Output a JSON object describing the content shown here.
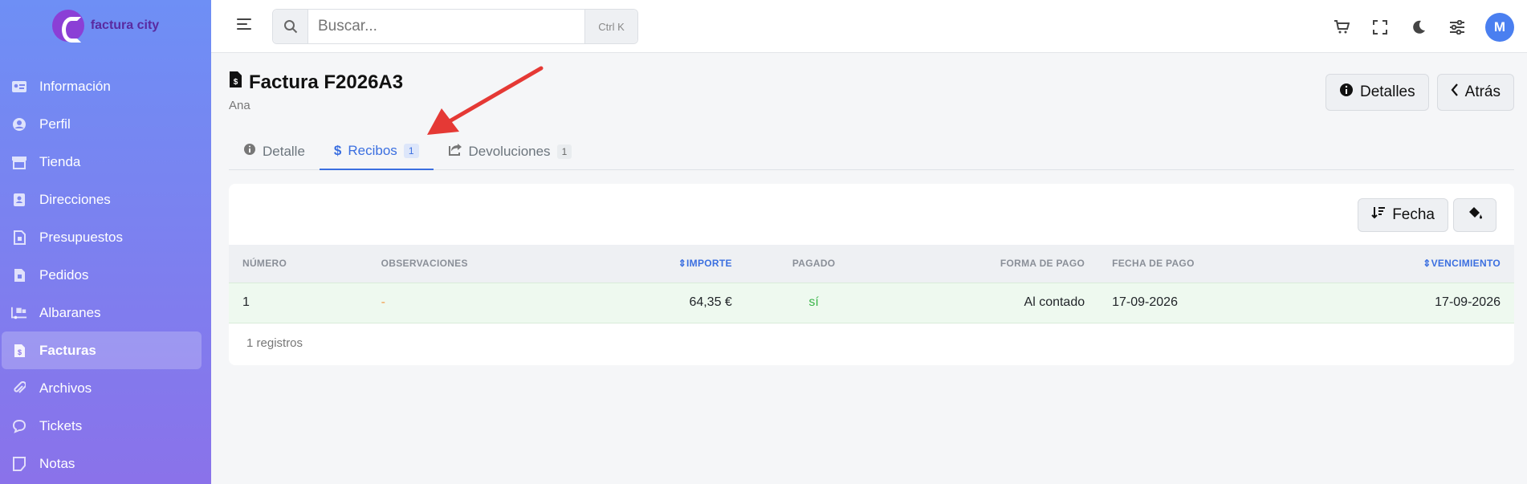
{
  "brand": {
    "name": "factura city"
  },
  "sidebar": {
    "items": [
      {
        "label": "Información",
        "icon": "id-card-icon"
      },
      {
        "label": "Perfil",
        "icon": "user-circle-icon"
      },
      {
        "label": "Tienda",
        "icon": "store-icon"
      },
      {
        "label": "Direcciones",
        "icon": "address-book-icon"
      },
      {
        "label": "Presupuestos",
        "icon": "file-icon"
      },
      {
        "label": "Pedidos",
        "icon": "file-icon"
      },
      {
        "label": "Albaranes",
        "icon": "truck-loading-icon"
      },
      {
        "label": "Facturas",
        "icon": "file-invoice-icon"
      },
      {
        "label": "Archivos",
        "icon": "paperclip-icon"
      },
      {
        "label": "Tickets",
        "icon": "comment-icon"
      },
      {
        "label": "Notas",
        "icon": "note-icon"
      }
    ],
    "active": "Facturas"
  },
  "topbar": {
    "search_placeholder": "Buscar...",
    "shortcut": "Ctrl K",
    "avatar_initial": "M"
  },
  "header": {
    "title": "Factura F2026A3",
    "subtitle": "Ana",
    "details_btn": "Detalles",
    "back_btn": "Atrás"
  },
  "tabs": [
    {
      "label": "Detalle",
      "badge": ""
    },
    {
      "label": "Recibos",
      "badge": "1"
    },
    {
      "label": "Devoluciones",
      "badge": "1"
    }
  ],
  "active_tab": "Recibos",
  "table": {
    "sort_btn": "Fecha",
    "columns": [
      "Número",
      "Observaciones",
      "Importe",
      "Pagado",
      "Forma de pago",
      "Fecha de pago",
      "Vencimiento"
    ],
    "rows": [
      {
        "numero": "1",
        "observaciones": "-",
        "importe": "64,35 €",
        "pagado": "sí",
        "forma_pago": "Al contado",
        "fecha_pago": "17-09-2026",
        "vencimiento": "17-09-2026"
      }
    ],
    "footer": "1 registros"
  },
  "colors": {
    "accent": "#3b6fe0",
    "sidebar_top": "#6e8ff5",
    "sidebar_bottom": "#8a72ea",
    "paid": "#3bb54a",
    "arrow": "#e53935"
  }
}
